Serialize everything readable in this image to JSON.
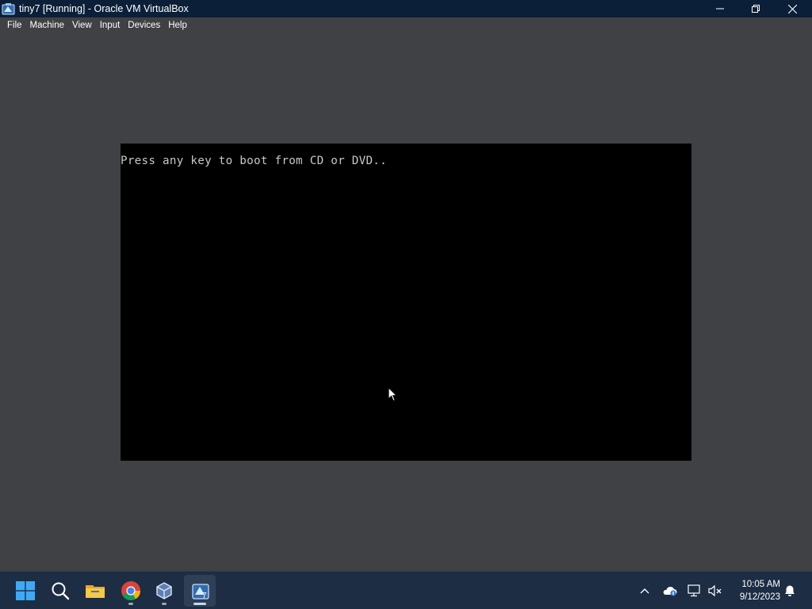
{
  "window": {
    "title": "tiny7 [Running] - Oracle VM VirtualBox",
    "icon": "virtualbox-icon",
    "controls": [
      "minimize-icon",
      "restore-icon",
      "close-icon"
    ]
  },
  "menu": {
    "items": [
      {
        "label": "File"
      },
      {
        "label": "Machine"
      },
      {
        "label": "View"
      },
      {
        "label": "Input"
      },
      {
        "label": "Devices"
      },
      {
        "label": "Help"
      }
    ]
  },
  "vm": {
    "console_text": "Press any key to boot from CD or DVD.."
  },
  "taskbar": {
    "apps": [
      {
        "name": "start-button",
        "icon": "windows-logo-icon"
      },
      {
        "name": "search-button",
        "icon": "search-icon"
      },
      {
        "name": "file-explorer",
        "icon": "folder-icon"
      },
      {
        "name": "chrome",
        "icon": "chrome-icon"
      },
      {
        "name": "virtualbox-manager",
        "icon": "virtualbox-cube-icon"
      },
      {
        "name": "tiny7-vm-window",
        "icon": "virtualbox-vm-icon"
      }
    ],
    "tray": [
      "chevron-up-icon",
      "onedrive-icon",
      "network-icon",
      "volume-muted-icon"
    ],
    "clock": {
      "time": "10:05 AM",
      "date": "9/12/2023"
    },
    "notification_icon": "bell-icon"
  },
  "colors": {
    "titlebar": "#0b2038",
    "background": "#3f4144",
    "vm_screen": "#000000",
    "console_text": "#c8c8c8",
    "taskbar": "#1c2d44"
  }
}
